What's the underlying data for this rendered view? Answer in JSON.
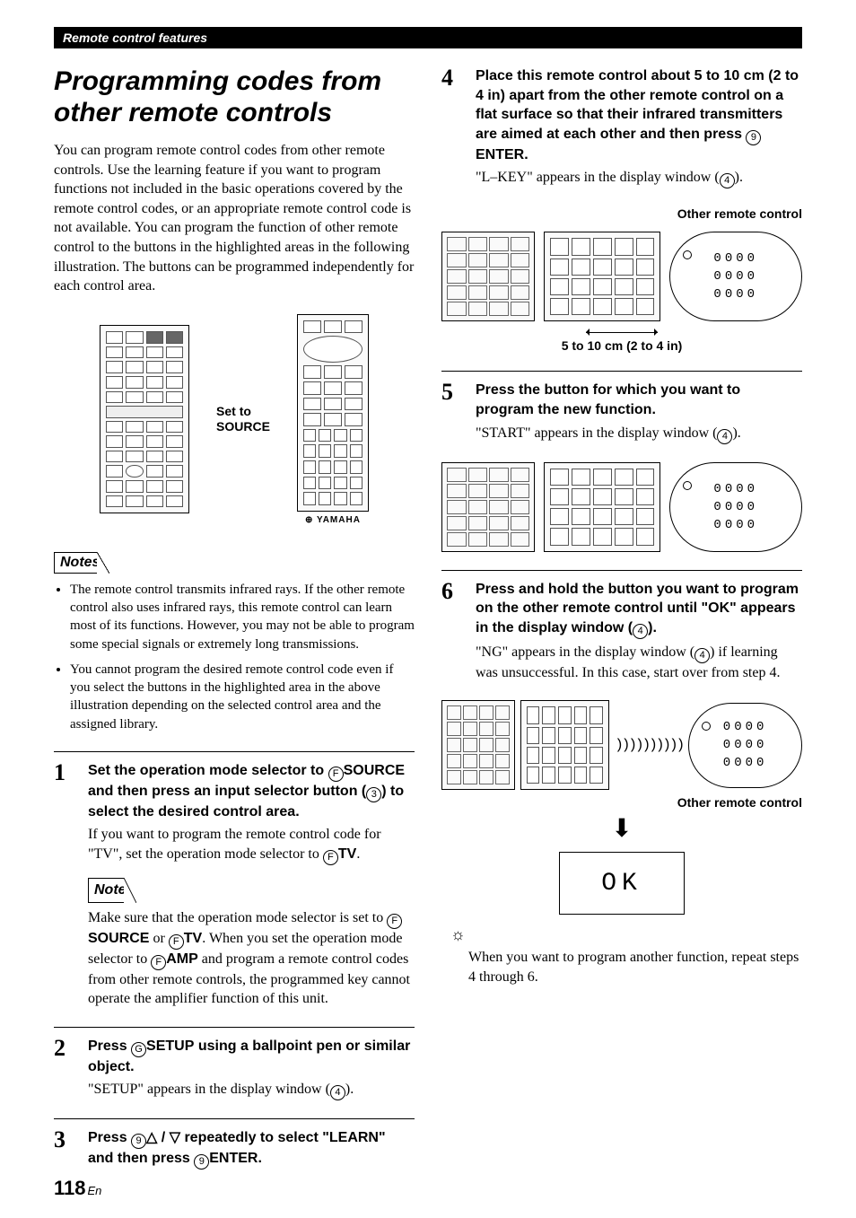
{
  "header": {
    "breadcrumb": "Remote control features"
  },
  "title": "Programming codes from other remote controls",
  "intro": "You can program remote control codes from other remote controls. Use the learning feature if you want to program functions not included in the basic operations covered by the remote control codes, or an appropriate remote control code is not available. You can program the function of other remote control to the buttons in the highlighted areas in the following illustration. The buttons can be programmed independently for each control area.",
  "figure_left": {
    "label_line1": "Set to",
    "label_line2": "SOURCE",
    "brand": "YAMAHA"
  },
  "notes": {
    "heading": "Notes",
    "items": [
      "The remote control transmits infrared rays. If the other remote control also uses infrared rays, this remote control can learn most of its functions. However, you may not be able to program some special signals or extremely long transmissions.",
      "You cannot program the desired remote control code even if you select the buttons in the highlighted area in the above illustration depending on the selected control area and the assigned library."
    ]
  },
  "steps": {
    "s1": {
      "num": "1",
      "lead_a": "Set the operation mode selector to ",
      "ref_a": "F",
      "bold_a": "SOURCE",
      "lead_b": " and then press an input selector button (",
      "ref_b": "3",
      "lead_c": ") to select the desired control area.",
      "follow_a": "If you want to program the remote control code for \"TV\", set the operation mode selector to ",
      "ref_c": "F",
      "bold_b": "TV",
      "follow_b": ".",
      "note_heading": "Note",
      "note_a": "Make sure that the operation mode selector is set to ",
      "note_ref1": "F",
      "note_b1": "SOURCE",
      "note_mid1": " or ",
      "note_ref2": "F",
      "note_b2": "TV",
      "note_mid2": ". When you set the operation mode selector to ",
      "note_ref3": "F",
      "note_b3": "AMP",
      "note_tail": " and program a remote control codes from other remote controls, the programmed key cannot operate the amplifier function of this unit."
    },
    "s2": {
      "num": "2",
      "lead_a": "Press ",
      "ref": "G",
      "bold": "SETUP",
      "lead_b": " using a ballpoint pen or similar object.",
      "follow_a": "\"SETUP\" appears in the display window (",
      "ref2": "4",
      "follow_b": ")."
    },
    "s3": {
      "num": "3",
      "lead_a": "Press ",
      "ref": "9",
      "glyphs": "△ / ▽",
      "lead_b": " repeatedly to select \"LEARN\" and then press ",
      "ref2": "9",
      "bold": "ENTER",
      "lead_c": "."
    },
    "s4": {
      "num": "4",
      "lead": "Place this remote control about 5 to 10 cm (2 to 4 in) apart from the other remote control on a flat surface so that their infrared transmitters are aimed at each other and then press ",
      "ref": "9",
      "bold": "ENTER",
      "lead_end": ".",
      "follow_a": "\"L–KEY\" appears in the display window (",
      "ref2": "4",
      "follow_b": ").",
      "caption_other": "Other remote control",
      "caption_dist": "5 to 10 cm (2 to 4 in)"
    },
    "s5": {
      "num": "5",
      "lead": "Press the button for which you want to program the new function.",
      "follow_a": "\"START\" appears in the display window (",
      "ref": "4",
      "follow_b": ")."
    },
    "s6": {
      "num": "6",
      "lead_a": "Press and hold the button you want to program on the other remote control until \"OK\" appears in the display window (",
      "ref": "4",
      "lead_b": ").",
      "follow_a": "\"NG\" appears in the display window (",
      "ref2": "4",
      "follow_b": ") if learning was unsuccessful. In this case, start over from step 4.",
      "caption_other": "Other remote control",
      "ok": "OK"
    }
  },
  "tip": "When you want to program another function, repeat steps 4 through 6.",
  "page_number": "118",
  "page_lang": "En",
  "oval_buttons": "0000"
}
